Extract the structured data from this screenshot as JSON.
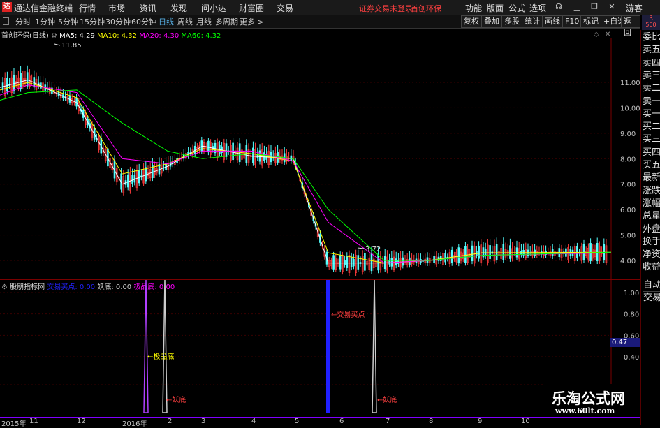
{
  "titlebar": {
    "logo": "达",
    "app_name": "通达信金融终端",
    "menus": [
      "行情",
      "市场",
      "资讯",
      "发现",
      "问小达",
      "财富圈",
      "交易"
    ],
    "warning": "证券交易未登录",
    "stock_name": "首创环保",
    "right_menus": [
      "功能",
      "版面",
      "公式",
      "选项"
    ],
    "user": "游客"
  },
  "r500": {
    "line1": "R",
    "line2": "500"
  },
  "period_tabs": [
    "分时",
    "1分钟",
    "5分钟",
    "15分钟",
    "30分钟",
    "60分钟",
    "日线",
    "周线",
    "月线",
    "多周期",
    "更多 >"
  ],
  "toolbar_right": [
    "复权",
    "叠加",
    "多股",
    "统计",
    "画线",
    "F10",
    "标记",
    "+自选",
    "返回"
  ],
  "chart_info": {
    "name": "首创环保(日线)",
    "ma5_label": "MA5: 4.29",
    "ma10_label": "MA10: 4.32",
    "ma20_label": "MA20: 4.30",
    "ma60_label": "MA60: 4.32"
  },
  "price_annotations": {
    "high": "11.85",
    "low": "3.72"
  },
  "y_axis_main": [
    "11.00",
    "10.00",
    "9.00",
    "8.00",
    "7.00",
    "6.00",
    "5.00",
    "4.00"
  ],
  "indicator_info": {
    "name": "股朋指标网",
    "label1": "交易买点: 0.00",
    "label2": "妖底: 0.00",
    "label3": "极品底: 0.00"
  },
  "y_axis_ind": [
    "1.00",
    "0.80",
    "0.60",
    "0.40"
  ],
  "current_value": "0.47",
  "signals": {
    "jipin": "←极品底",
    "yao1": "←妖底",
    "buy": "←交易买点",
    "yao2": "←妖底"
  },
  "x_axis": [
    "2015年",
    "11",
    "12",
    "2016年",
    "2",
    "3",
    "4",
    "5",
    "6",
    "7",
    "8",
    "9",
    "10"
  ],
  "side_panel": [
    "委比",
    "卖五",
    "卖四",
    "卖三",
    "卖二",
    "卖一",
    "买一",
    "买二",
    "买三",
    "买四",
    "买五",
    "最新",
    "涨跌",
    "涨幅",
    "总量",
    "外盘",
    "换手",
    "净资",
    "收益",
    "自动",
    "交易"
  ],
  "watermark": {
    "main": "乐淘公式网",
    "url": "www.60lt.com"
  },
  "colors": {
    "ma5": "#ffffff",
    "ma10": "#ffff00",
    "ma20": "#ff00ff",
    "ma60": "#00ff00",
    "accent": "#5ad"
  },
  "chart_data": {
    "type": "line",
    "title": "首创环保(日线)",
    "x": [
      "2015-10",
      "2015-11",
      "2015-12",
      "2016-01",
      "2016-02",
      "2016-03",
      "2016-04",
      "2016-05",
      "2016-06",
      "2016-07",
      "2016-08",
      "2016-09",
      "2016-10"
    ],
    "series": [
      {
        "name": "MA5",
        "values": [
          10.8,
          11.1,
          10.2,
          7.0,
          7.7,
          8.5,
          8.1,
          8.0,
          3.9,
          3.9,
          4.0,
          4.3,
          4.29
        ]
      },
      {
        "name": "MA10",
        "values": [
          10.7,
          11.0,
          10.4,
          7.4,
          7.8,
          8.4,
          8.2,
          7.9,
          4.3,
          3.9,
          4.0,
          4.3,
          4.32
        ]
      },
      {
        "name": "MA20",
        "values": [
          10.5,
          10.9,
          10.6,
          8.0,
          7.8,
          8.3,
          8.3,
          7.9,
          5.5,
          3.9,
          4.0,
          4.2,
          4.3
        ]
      },
      {
        "name": "MA60",
        "values": [
          10.3,
          10.6,
          10.7,
          9.4,
          8.3,
          8.0,
          8.2,
          8.0,
          6.0,
          4.0,
          4.0,
          4.2,
          4.32
        ]
      }
    ],
    "ylim": [
      3.5,
      12.0
    ]
  }
}
